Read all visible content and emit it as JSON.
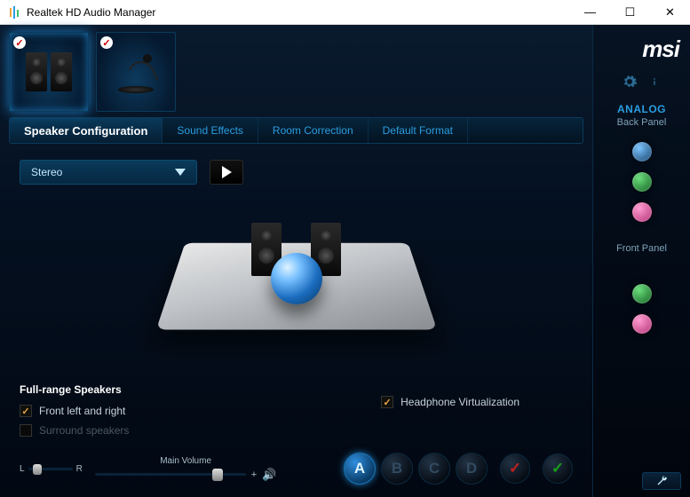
{
  "window": {
    "title": "Realtek HD Audio Manager"
  },
  "brand": "msi",
  "tabs": [
    {
      "label": "Speaker Configuration"
    },
    {
      "label": "Sound Effects"
    },
    {
      "label": "Room Correction"
    },
    {
      "label": "Default Format"
    }
  ],
  "config": {
    "mode": "Stereo",
    "full_range_title": "Full-range Speakers",
    "front_lr": "Front left and right",
    "surround": "Surround speakers",
    "headphone_virt": "Headphone Virtualization"
  },
  "volume": {
    "balance_left": "L",
    "balance_right": "R",
    "main_label": "Main Volume",
    "plus": "+"
  },
  "presets": {
    "a": "A",
    "b": "B",
    "c": "C",
    "d": "D"
  },
  "side": {
    "analog": "ANALOG",
    "back": "Back Panel",
    "front": "Front Panel"
  }
}
